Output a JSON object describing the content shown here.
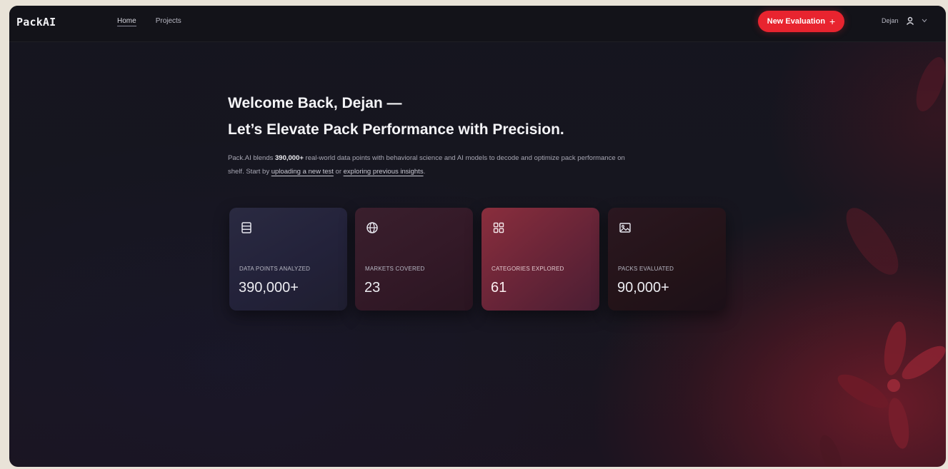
{
  "brand": {
    "name": "PackAI"
  },
  "nav": {
    "home": "Home",
    "projects": "Projects"
  },
  "actions": {
    "new_evaluation": "New Evaluation",
    "new_evaluation_icon": "+"
  },
  "user": {
    "name": "Dejan",
    "avatar_icon": "user-icon",
    "menu_icon": "chevron-down-icon"
  },
  "hero": {
    "line1": "Welcome Back, Dejan —",
    "line2": "Let’s Elevate Pack Performance with Precision.",
    "intro_a": "Pack.AI blends ",
    "intro_bold": "390,000+",
    "intro_b": " real-world data points with behavioral science and AI models to decode and optimize pack performance on shelf. Start by ",
    "link_upload": "uploading a new test",
    "intro_c": " or ",
    "link_explore": "exploring previous insights",
    "intro_d": "."
  },
  "stats": [
    {
      "label": "DATA POINTS ANALYZED",
      "value": "390,000+",
      "icon": "database-icon"
    },
    {
      "label": "MARKETS COVERED",
      "value": "23",
      "icon": "globe-icon"
    },
    {
      "label": "CATEGORIES EXPLORED",
      "value": "61",
      "icon": "grid-icon"
    },
    {
      "label": "PACKS EVALUATED",
      "value": "90,000+",
      "icon": "image-icon"
    }
  ],
  "colors": {
    "accent": "#e8242f",
    "background": "#15151f"
  }
}
